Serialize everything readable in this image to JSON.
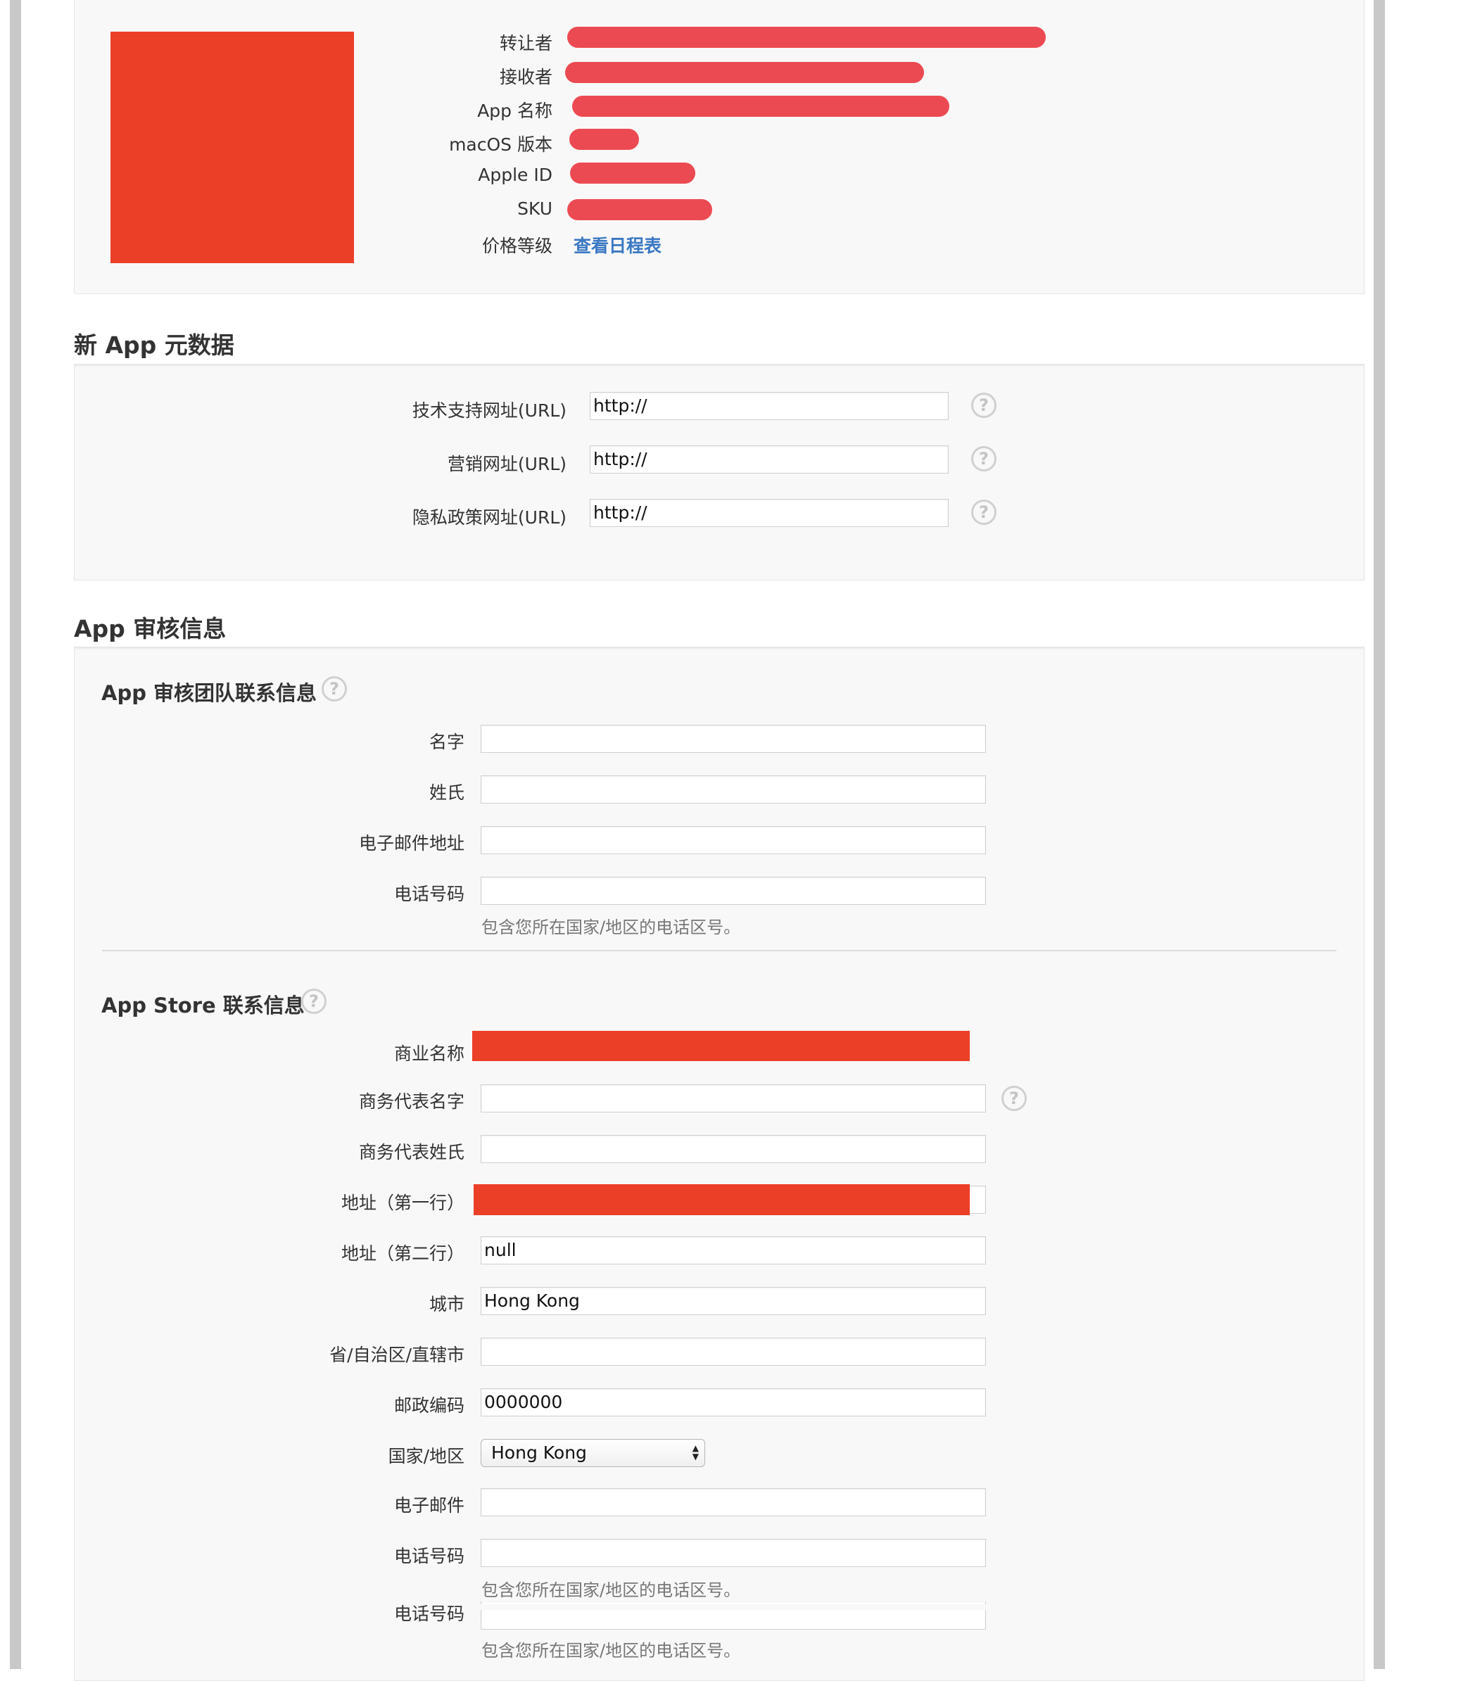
{
  "top_info": {
    "rows": [
      {
        "label": "转让者",
        "bar_len": 0.95
      },
      {
        "label": "接收者",
        "bar_len": 0.74
      },
      {
        "label": "App 名称",
        "bar_len": 0.75
      },
      {
        "label": "macOS 版本",
        "bar_len": 0.14
      },
      {
        "label": "Apple ID",
        "bar_len": 0.26
      },
      {
        "label": "SKU",
        "bar_len": 0.29
      }
    ],
    "price_label": "价格等级",
    "price_link": "查看日程表"
  },
  "metadata": {
    "title": "新 App 元数据",
    "fields": [
      {
        "label": "技术支持网址(URL)",
        "value": "http://"
      },
      {
        "label": "营销网址(URL)",
        "value": "http://"
      },
      {
        "label": "隐私政策网址(URL)",
        "value": "http://"
      }
    ],
    "help_glyph": "?"
  },
  "review": {
    "title": "App 审核信息",
    "team_contact": {
      "title": "App 审核团队联系信息",
      "first_name": "名字",
      "last_name": "姓氏",
      "email": "电子邮件地址",
      "phone": "电话号码",
      "phone_hint": "包含您所在国家/地区的电话区号。"
    },
    "store_contact": {
      "title": "App Store 联系信息",
      "business_name": "商业名称",
      "rep_first_name": "商务代表名字",
      "rep_last_name": "商务代表姓氏",
      "address1": "地址（第一行）",
      "address2": {
        "label": "地址（第二行）",
        "value": "null"
      },
      "city": {
        "label": "城市",
        "value": "Hong Kong"
      },
      "province": "省/自治区/直辖市",
      "postal": {
        "label": "邮政编码",
        "value": "0000000"
      },
      "country": {
        "label": "国家/地区",
        "value": "Hong Kong"
      },
      "email": "电子邮件",
      "phone": "电话号码",
      "phone_hint": "包含您所在国家/地区的电话区号。",
      "phone_dup": "电话号码",
      "phone_hint_dup": "包含您所在国家/地区的电话区号。"
    }
  },
  "colors": {
    "redaction": "#ec3f27",
    "redbar": "#ec4a52",
    "link": "#3a78c3",
    "panel_bg": "#f8f8f8"
  }
}
